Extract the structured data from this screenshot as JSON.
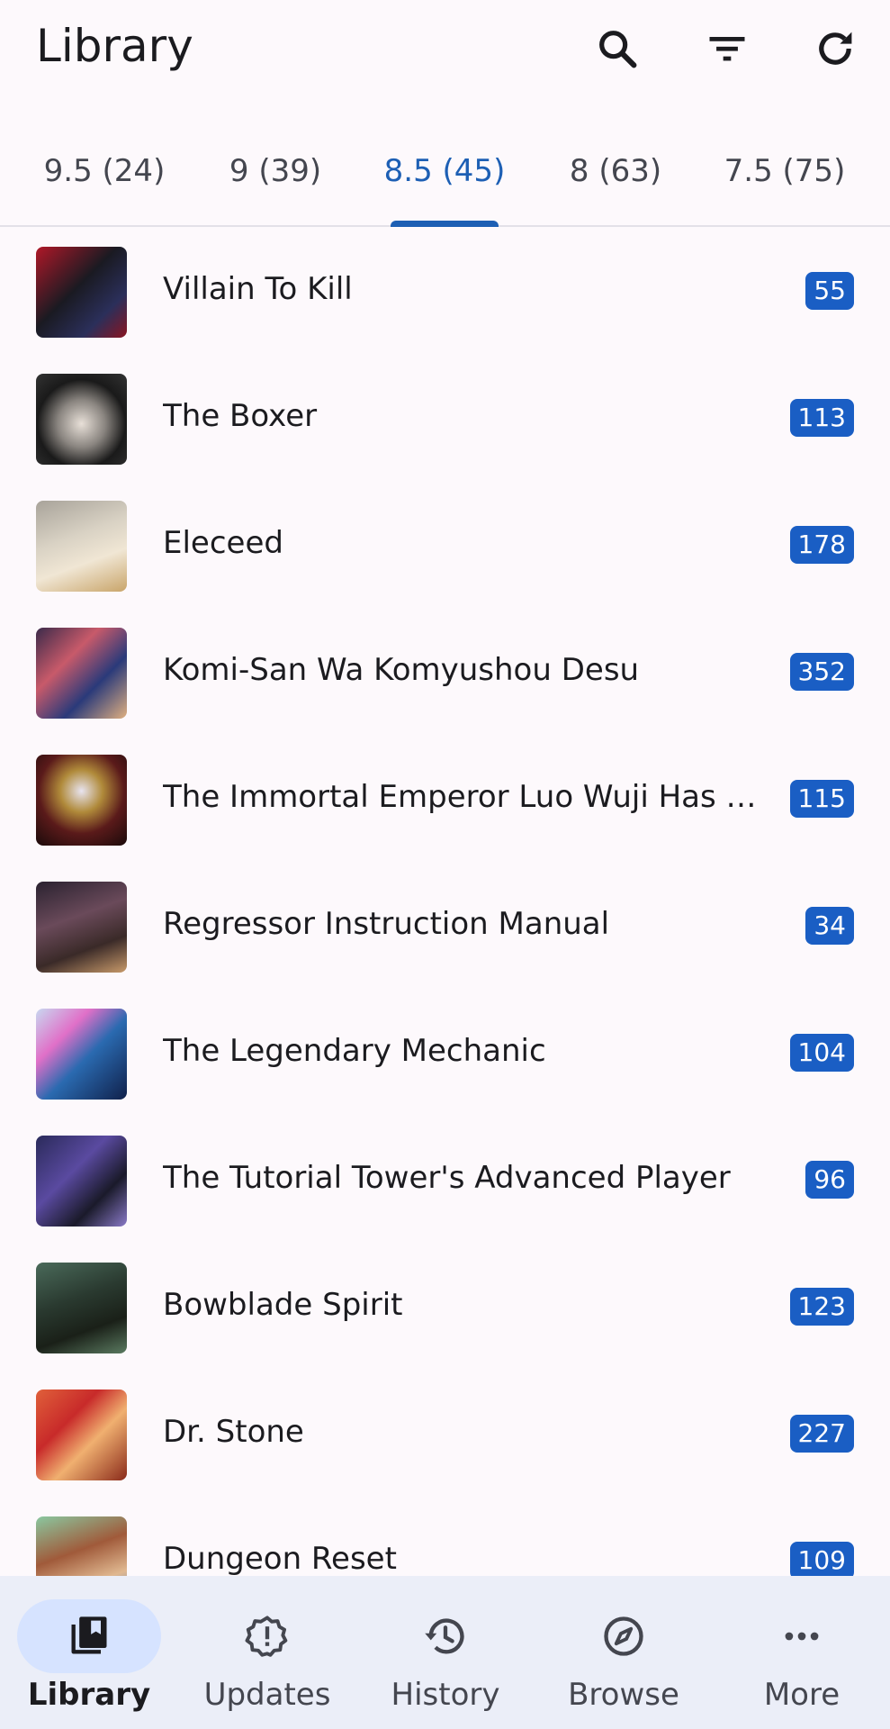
{
  "header": {
    "title": "Library",
    "icons": [
      "search-icon",
      "filter-icon",
      "refresh-icon"
    ]
  },
  "tabs": [
    {
      "label": "9.5 (24)",
      "active": false
    },
    {
      "label": "9 (39)",
      "active": false
    },
    {
      "label": "8.5 (45)",
      "active": true
    },
    {
      "label": "8 (63)",
      "active": false
    },
    {
      "label": "7.5 (75)",
      "active": false
    }
  ],
  "items": [
    {
      "title": "Villain To Kill",
      "count": "55"
    },
    {
      "title": "The Boxer",
      "count": "113"
    },
    {
      "title": "Eleceed",
      "count": "178"
    },
    {
      "title": "Komi-San Wa Komyushou Desu",
      "count": "352"
    },
    {
      "title": "The Immortal Emperor Luo Wuji Has Re...",
      "count": "115"
    },
    {
      "title": "Regressor Instruction Manual",
      "count": "34"
    },
    {
      "title": "The Legendary Mechanic",
      "count": "104"
    },
    {
      "title": "The Tutorial Tower's Advanced Player",
      "count": "96"
    },
    {
      "title": "Bowblade Spirit",
      "count": "123"
    },
    {
      "title": "Dr. Stone",
      "count": "227"
    },
    {
      "title": "Dungeon Reset",
      "count": "109"
    }
  ],
  "nav": [
    {
      "label": "Library",
      "icon": "library-icon",
      "active": true
    },
    {
      "label": "Updates",
      "icon": "updates-icon",
      "active": false
    },
    {
      "label": "History",
      "icon": "history-icon",
      "active": false
    },
    {
      "label": "Browse",
      "icon": "browse-icon",
      "active": false
    },
    {
      "label": "More",
      "icon": "more-icon",
      "active": false
    }
  ],
  "colors": {
    "accent": "#1d5fb4",
    "badge": "#1a5ec4",
    "background": "#fdf9fc",
    "nav_background": "#ebeef8",
    "nav_active_pill": "#d6e3ff"
  }
}
